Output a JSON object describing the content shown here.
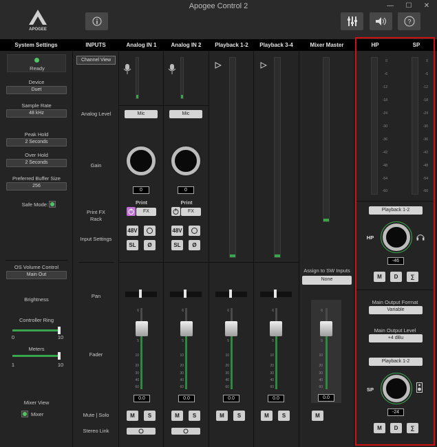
{
  "window": {
    "title": "Apogee Control 2",
    "logo_text": "APOGEE"
  },
  "columns": {
    "system_settings": "System Settings",
    "inputs": "INPUTS",
    "analog_in_1": "Analog IN 1",
    "analog_in_2": "Analog IN 2",
    "playback_1_2": "Playback 1-2",
    "playback_3_4": "Playback 3-4",
    "mixer_master": "Mixer Master",
    "hp": "HP",
    "sp": "SP"
  },
  "system": {
    "status": "Ready",
    "device_label": "Device",
    "device_value": "Duet",
    "sample_rate_label": "Sample Rate",
    "sample_rate_value": "48 kHz",
    "peak_hold_label": "Peak Hold",
    "peak_hold_value": "2 Seconds",
    "over_hold_label": "Over Hold",
    "over_hold_value": "2 Seconds",
    "buffer_label": "Preferred Buffer Size",
    "buffer_value": "256",
    "safe_mode_label": "Safe Mode:",
    "os_volume_label": "OS Volume Control",
    "os_volume_value": "Main Out",
    "brightness_label": "Brightness",
    "controller_ring_label": "Controller Ring",
    "controller_ring_min": "0",
    "controller_ring_max": "10",
    "controller_ring_level": 1.0,
    "meters_label": "Meters",
    "meters_min": "1",
    "meters_max": "10",
    "meters_level": 1.0,
    "mixer_view_label": "Mixer View",
    "mixer_label": "Mixer"
  },
  "inputs_labels": {
    "channel_view": "Channel View",
    "analog_level": "Analog Level",
    "gain": "Gain",
    "print_fx": "Print FX",
    "rack": "Rack",
    "input_settings": "Input Settings",
    "pan": "Pan",
    "fader": "Fader",
    "mute_solo": "Mute | Solo",
    "stereo_link": "Stereo Link"
  },
  "analog1": {
    "level": "Mic",
    "gain": "0",
    "print": "Print",
    "fx": "FX",
    "phantom": "48V",
    "sl": "SL",
    "phase": "Ø",
    "fader": "0.0",
    "mute": "M",
    "solo": "S"
  },
  "analog2": {
    "level": "Mic",
    "gain": "0",
    "print": "Print",
    "fx": "FX",
    "phantom": "48V",
    "sl": "SL",
    "phase": "Ø",
    "fader": "0.0",
    "mute": "M",
    "solo": "S"
  },
  "playback12": {
    "fader": "0.0",
    "mute": "M",
    "solo": "S"
  },
  "playback34": {
    "fader": "0.0",
    "mute": "M",
    "solo": "S"
  },
  "master": {
    "assign_label": "Assign to SW Inputs",
    "assign_value": "None",
    "fader": "0.0",
    "mute": "M"
  },
  "meter_scale": [
    "0",
    "-6",
    "-12",
    "-18",
    "-24",
    "-30",
    "-36",
    "-42",
    "-48",
    "-54",
    "-60"
  ],
  "fader_scale": [
    "6",
    "0",
    "5",
    "10",
    "20",
    "30",
    "40",
    "60"
  ],
  "hp": {
    "source": "Playback 1-2",
    "label": "HP",
    "value": "-46",
    "m": "M",
    "d": "D",
    "sum": "∑"
  },
  "sp": {
    "format_label": "Main Output Format",
    "format_value": "Variable",
    "level_label": "Main Output Level",
    "level_value": "+4 dBu",
    "source": "Playback 1-2",
    "label": "SP",
    "value": "-24",
    "m": "M",
    "d": "D",
    "sum": "∑"
  },
  "colors": {
    "accent_green": "#3aa54d",
    "highlight_red": "#d01010",
    "print_purple": "#c270d6"
  }
}
